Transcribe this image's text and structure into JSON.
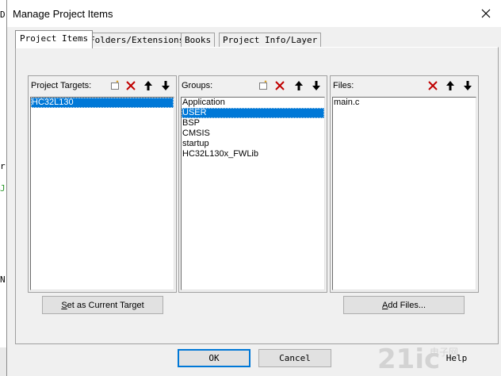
{
  "background_fragments": {
    "chars": [
      "D",
      "r",
      "J",
      "N"
    ]
  },
  "window": {
    "title": "Manage Project Items",
    "close_icon": "close-icon"
  },
  "tabs": [
    {
      "label": "Project Items",
      "active": true
    },
    {
      "label": "Folders/Extensions",
      "active": false
    },
    {
      "label": "Books",
      "active": false
    },
    {
      "label": "Project Info/Layer",
      "active": false
    }
  ],
  "targets": {
    "label": "Project Targets:",
    "items": [
      "HC32L130"
    ],
    "selected_index": 0,
    "button_label": "Set as Current Target",
    "button_accel": "S"
  },
  "groups": {
    "label": "Groups:",
    "items": [
      "Application",
      "USER",
      "BSP",
      "CMSIS",
      "startup",
      "HC32L130x_FWLib"
    ],
    "selected_index": 1
  },
  "files": {
    "label": "Files:",
    "items": [
      "main.c"
    ],
    "button_label": "Add Files...",
    "button_accel": "A"
  },
  "footer": {
    "ok_label": "OK",
    "cancel_label": "Cancel",
    "help_label": "Help"
  },
  "watermark": {
    "text": "21ic",
    "subtext": "电子网"
  },
  "colors": {
    "selection": "#0078d7",
    "delete_icon": "#c00000",
    "face": "#f0f0f0"
  }
}
